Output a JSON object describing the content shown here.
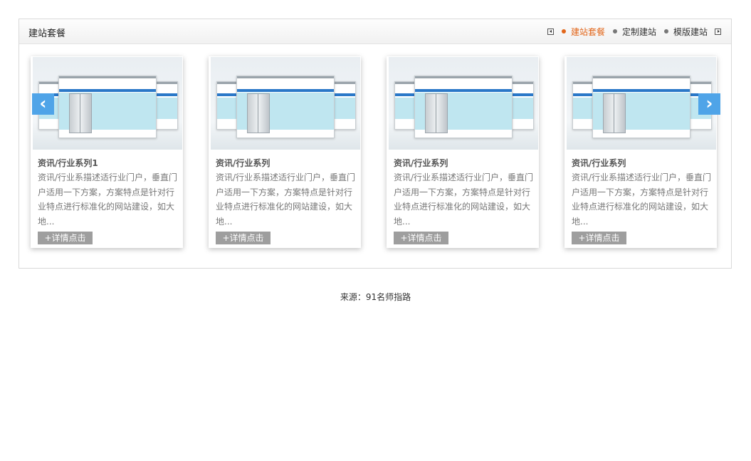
{
  "panel": {
    "title": "建站套餐",
    "tabs": [
      {
        "label": "建站套餐",
        "active": true
      },
      {
        "label": "定制建站",
        "active": false
      },
      {
        "label": "模版建站",
        "active": false
      }
    ],
    "prev_icon": "arrow-left-small-icon",
    "next_icon": "arrow-right-small-icon",
    "accent_color": "#e2661a"
  },
  "carousel": {
    "prev_glyph": "‹",
    "next_glyph": "›",
    "arrow_color": "#4fa4e8",
    "cards": [
      {
        "title": "资讯/行业系列1",
        "desc": "资讯/行业系描述适行业门户，垂直门户适用一下方案，方案特点是针对行业特点进行标准化的网站建设，如大地...",
        "button": "+详情点击"
      },
      {
        "title": "资讯/行业系列",
        "desc": "资讯/行业系描述适行业门户，垂直门户适用一下方案，方案特点是针对行业特点进行标准化的网站建设，如大地...",
        "button": "+详情点击"
      },
      {
        "title": "资讯/行业系列",
        "desc": "资讯/行业系描述适行业门户，垂直门户适用一下方案，方案特点是针对行业特点进行标准化的网站建设，如大地...",
        "button": "+详情点击"
      },
      {
        "title": "资讯/行业系列",
        "desc": "资讯/行业系描述适行业门户，垂直门户适用一下方案，方案特点是针对行业特点进行标准化的网站建设，如大地...",
        "button": "+详情点击"
      }
    ]
  },
  "footer": {
    "source": "来源：91名师指路"
  }
}
